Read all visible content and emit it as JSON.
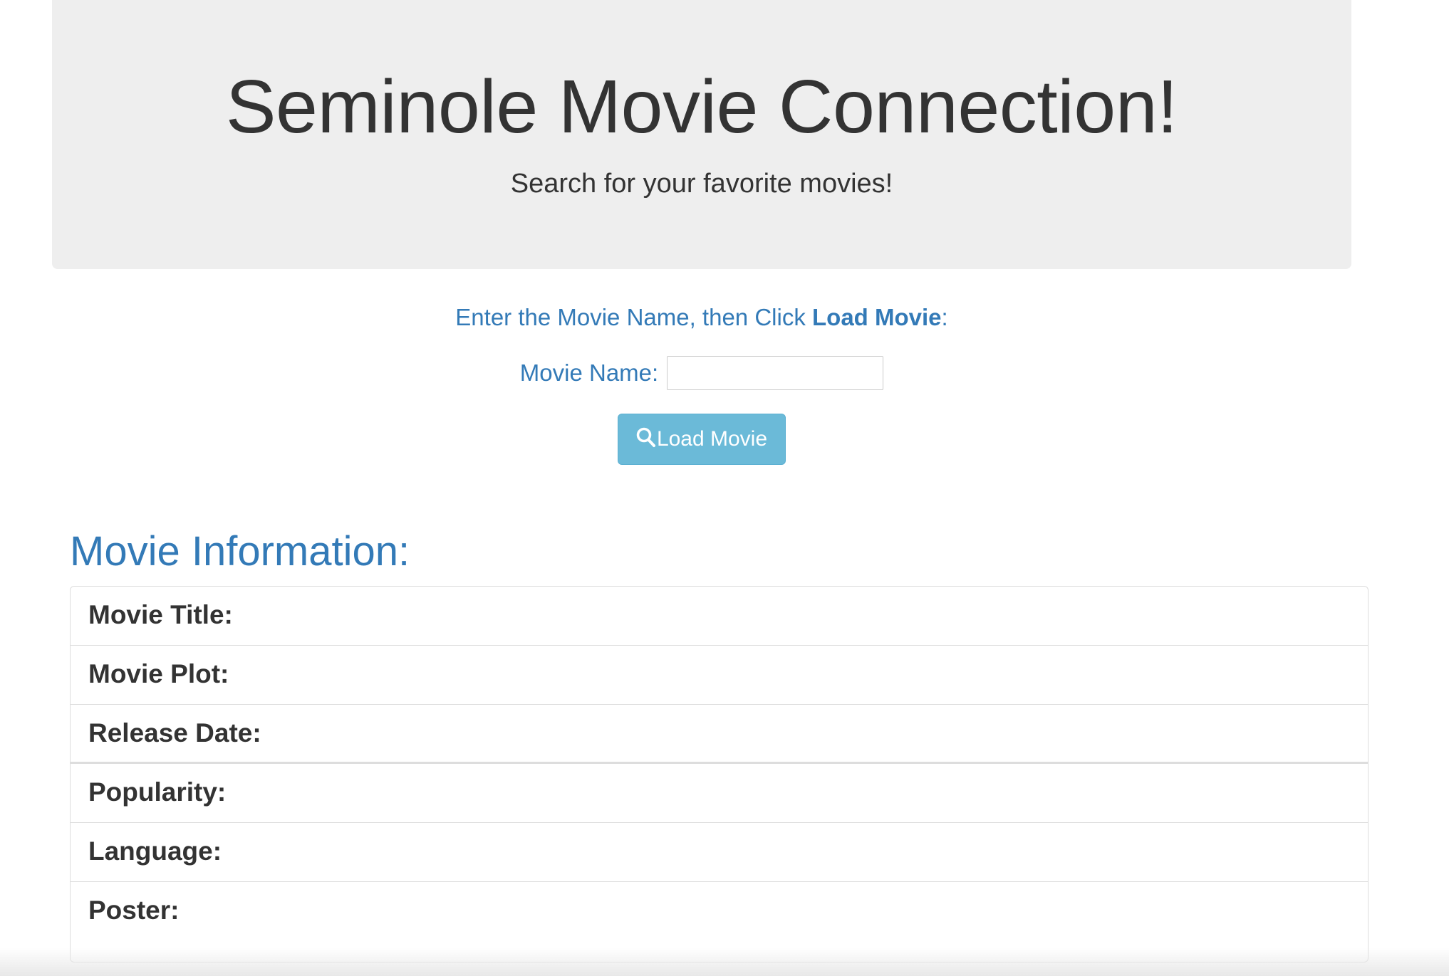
{
  "header": {
    "title": "Seminole Movie Connection!",
    "subtitle": "Search for your favorite movies!"
  },
  "search": {
    "instruction_prefix": "Enter the Movie Name, then Click ",
    "instruction_emphasis": "Load Movie",
    "instruction_suffix": ":",
    "movie_name_label": "Movie Name:",
    "movie_name_value": "",
    "button_label": "Load Movie",
    "button_icon": "search-icon"
  },
  "info": {
    "heading": "Movie Information:",
    "rows": [
      {
        "label": "Movie Title:"
      },
      {
        "label": "Movie Plot:"
      },
      {
        "label": "Release Date:"
      },
      {
        "label": "Popularity:"
      },
      {
        "label": "Language:"
      },
      {
        "label": "Poster:"
      }
    ]
  },
  "colors": {
    "accent": "#337ab7",
    "button": "#6bbad8",
    "jumbotron": "#eeeeee"
  }
}
